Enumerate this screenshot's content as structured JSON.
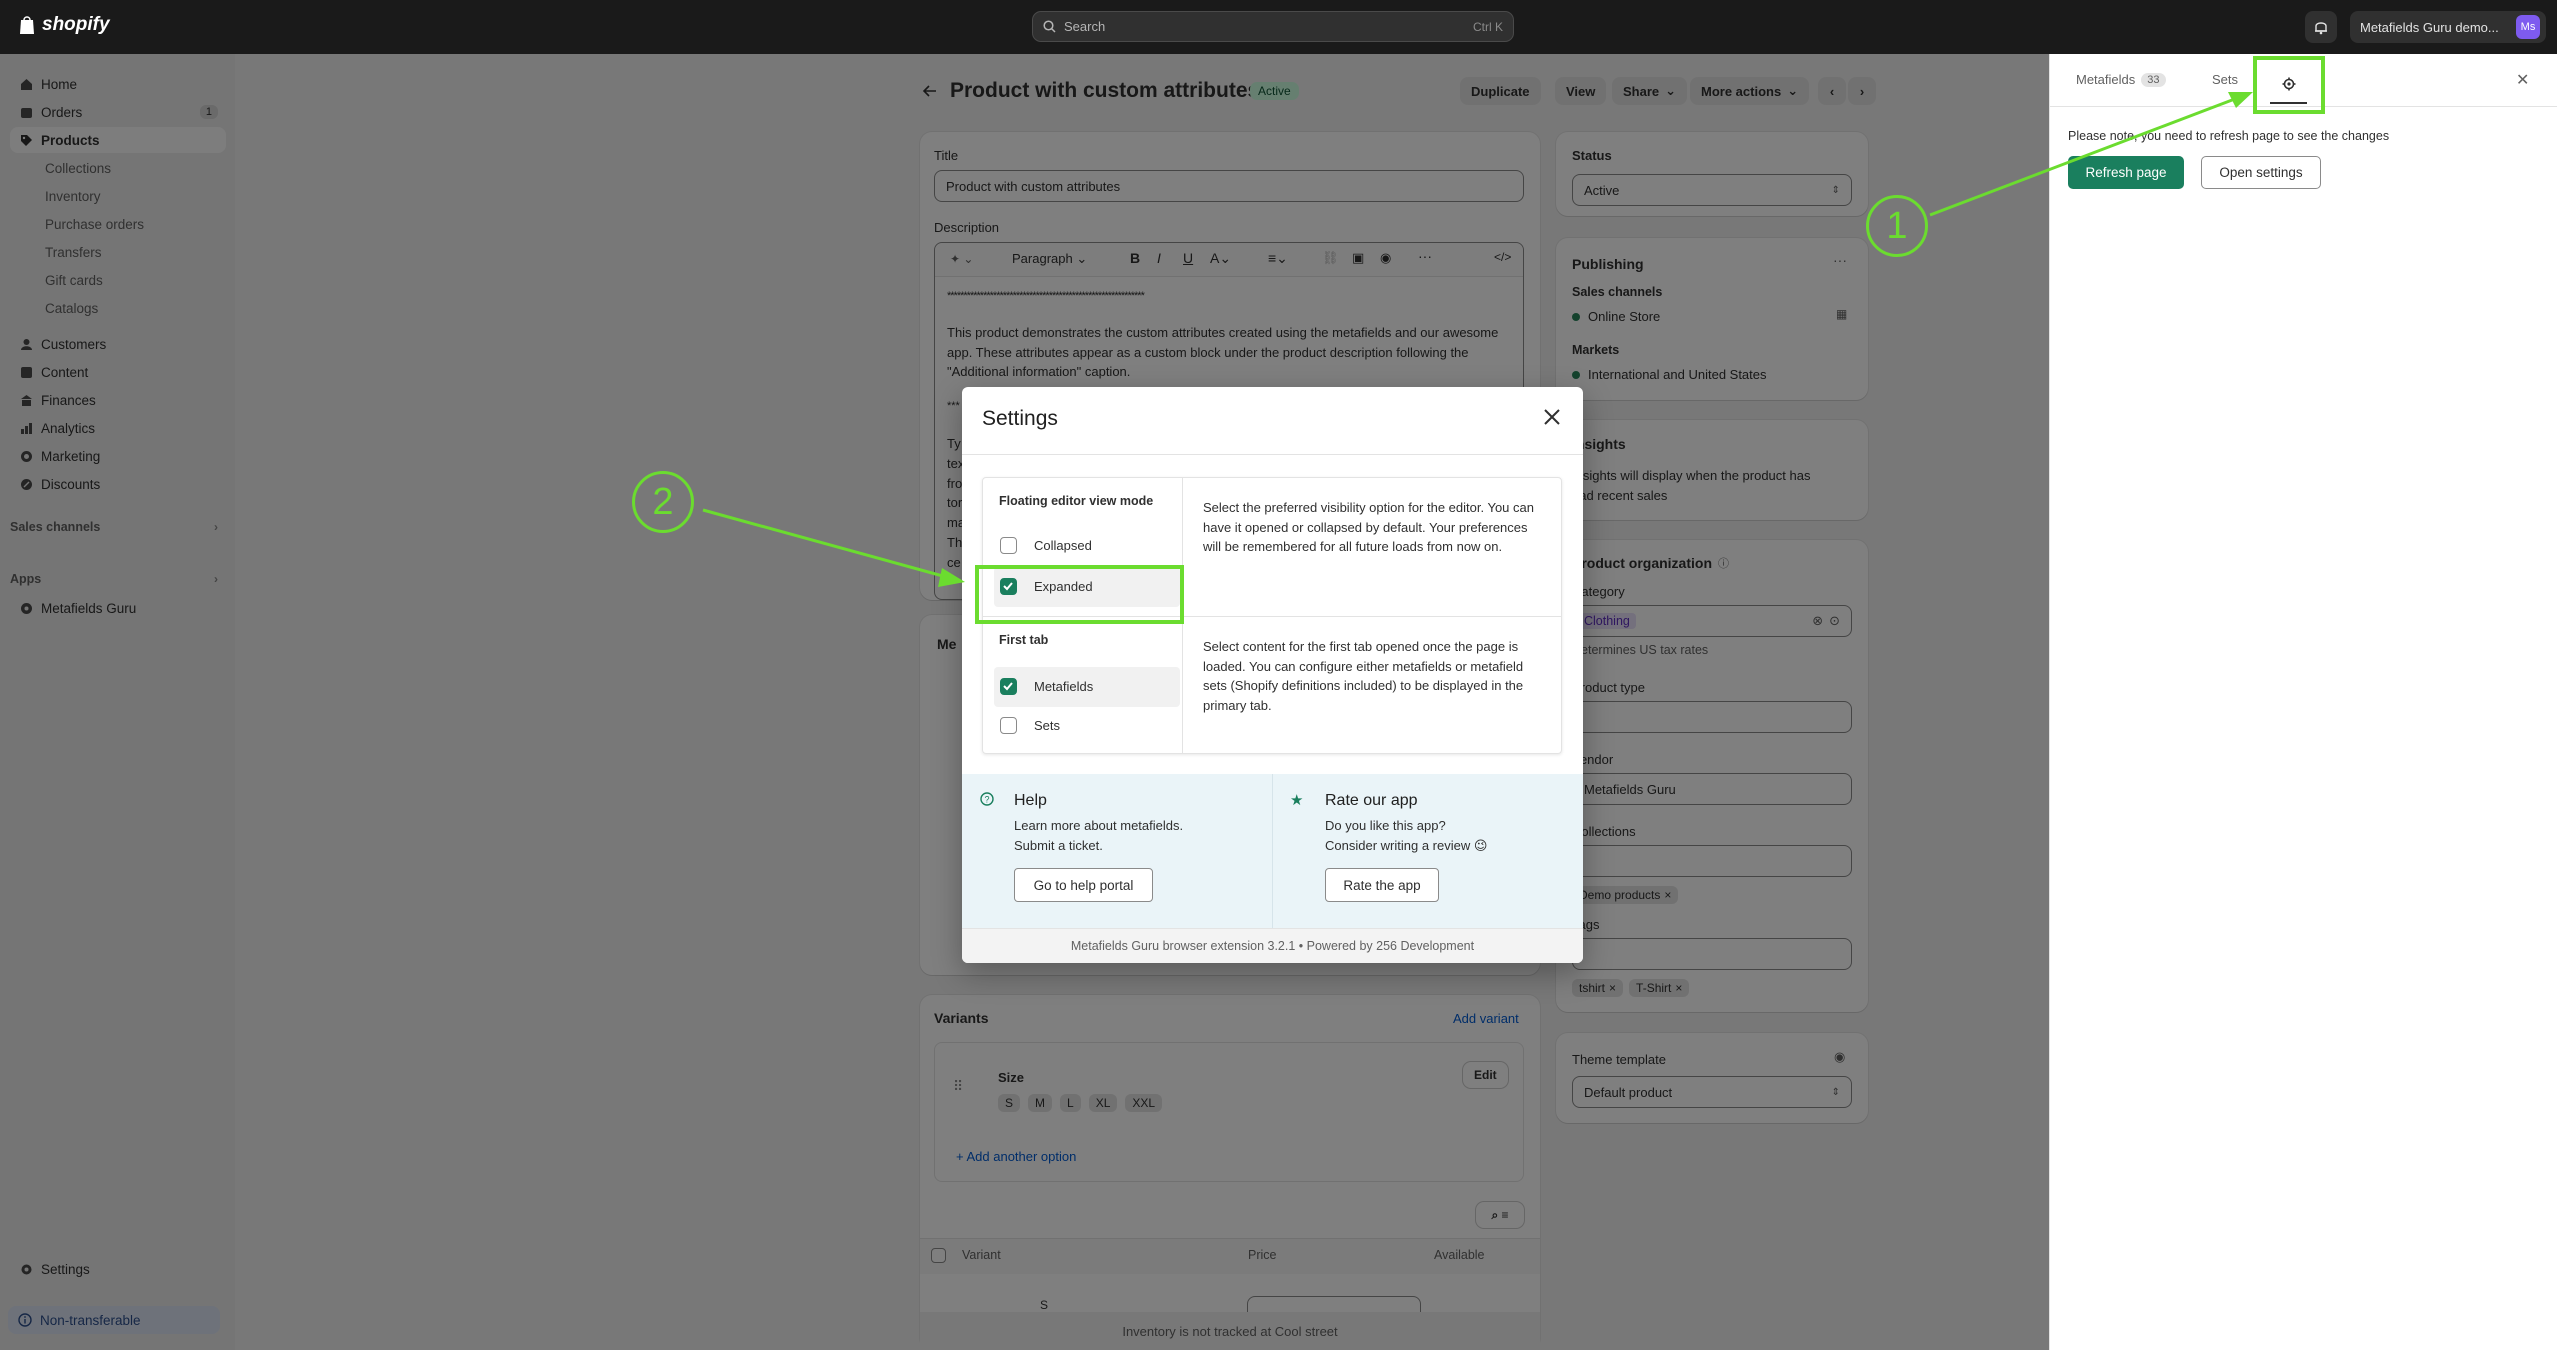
{
  "topbar": {
    "brand": "shopify",
    "search_placeholder": "Search",
    "search_shortcut": "Ctrl K",
    "store_name": "Metafields Guru demo...",
    "avatar_initials": "Ms"
  },
  "sidebar": {
    "items": [
      {
        "label": "Home"
      },
      {
        "label": "Orders",
        "badge": "1"
      },
      {
        "label": "Products"
      },
      {
        "label": "Collections"
      },
      {
        "label": "Inventory"
      },
      {
        "label": "Purchase orders"
      },
      {
        "label": "Transfers"
      },
      {
        "label": "Gift cards"
      },
      {
        "label": "Catalogs"
      },
      {
        "label": "Customers"
      },
      {
        "label": "Content"
      },
      {
        "label": "Finances"
      },
      {
        "label": "Analytics"
      },
      {
        "label": "Marketing"
      },
      {
        "label": "Discounts"
      }
    ],
    "sales_channels": "Sales channels",
    "apps": "Apps",
    "app_item": "Metafields Guru",
    "settings": "Settings",
    "non_transferable": "Non-transferable"
  },
  "product": {
    "title": "Product with custom attributes",
    "status_badge": "Active",
    "actions": {
      "duplicate": "Duplicate",
      "view": "View",
      "share": "Share",
      "more": "More actions"
    },
    "title_label": "Title",
    "title_value": "Product with custom attributes",
    "description_label": "Description",
    "toolbar_paragraph": "Paragraph",
    "desc_stars": "************************************************************",
    "desc_para": "This product demonstrates the custom attributes created using the metafields and our awesome app. These attributes appear as a custom block under the product description following the \"Additional information\" caption.",
    "desc_stars2": "***",
    "desc_frag": [
      "Ty",
      "tex",
      "fro",
      "tor",
      "ma",
      "Th",
      "ce"
    ],
    "media_frag": "Me",
    "variants": {
      "title": "Variants",
      "add_variant": "Add variant",
      "option_name": "Size",
      "edit": "Edit",
      "values": [
        "S",
        "M",
        "L",
        "XL",
        "XXL"
      ],
      "add_option": "+ Add another option",
      "col_variant": "Variant",
      "col_price": "Price",
      "col_available": "Available",
      "row_frag": "S"
    },
    "inventory_note": "Inventory is not tracked at Cool street"
  },
  "right_column": {
    "status_label": "Status",
    "status_value": "Active",
    "publishing": "Publishing",
    "sales_channels": "Sales channels",
    "online_store": "Online Store",
    "markets": "Markets",
    "markets_value": "International and United States",
    "insights_title": "Insights",
    "insights_text": "Insights will display when the product has had recent sales",
    "org_title": "Product organization",
    "category_label": "Category",
    "category_value": "Clothing",
    "category_note": "Determines US tax rates",
    "type_label": "Product type",
    "vendor_label": "Vendor",
    "vendor_value": "Metafields Guru",
    "collections_label": "Collections",
    "collection_tag": "Demo products",
    "tags_label": "Tags",
    "tags": [
      "tshirt",
      "T-Shirt"
    ],
    "theme_label": "Theme template",
    "theme_value": "Default product"
  },
  "panel": {
    "tab_metafields": "Metafields",
    "metafields_count": "33",
    "tab_sets": "Sets",
    "notice": "Please note, you need to refresh page to see the changes",
    "refresh_button": "Refresh page",
    "open_settings_button": "Open settings"
  },
  "modal": {
    "title": "Settings",
    "section1_title": "Floating editor view mode",
    "opt_collapsed": "Collapsed",
    "opt_expanded": "Expanded",
    "section1_desc": "Select the preferred visibility option for the editor. You can have it opened or collapsed by default. Your preferences will be remembered for all future loads from now on.",
    "section2_title": "First tab",
    "opt_metafields": "Metafields",
    "opt_sets": "Sets",
    "section2_desc": "Select content for the first tab opened once the page is loaded. You can configure either metafields or metafield sets (Shopify definitions included) to be displayed in the primary tab.",
    "help_title": "Help",
    "help_line1": "Learn more about metafields.",
    "help_line2": "Submit a ticket.",
    "help_button": "Go to help portal",
    "rate_title": "Rate our app",
    "rate_line1": "Do you like this app?",
    "rate_line2": "Consider writing a review 😉",
    "rate_button": "Rate the app",
    "footer": "Metafields Guru browser extension 3.2.1 • Powered by 256 Development"
  },
  "annotations": {
    "first": "1",
    "second": "2",
    "color": "#6bdc2f"
  }
}
